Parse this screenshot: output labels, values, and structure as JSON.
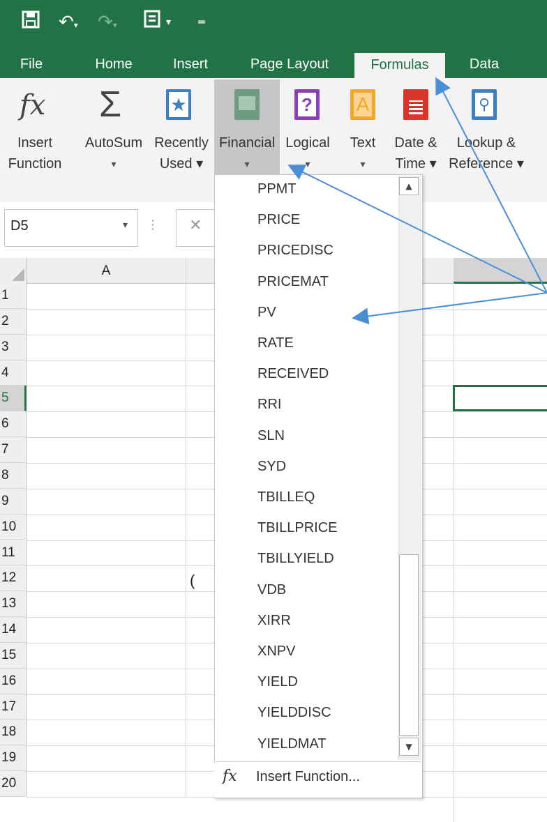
{
  "tabs": [
    {
      "label": "File"
    },
    {
      "label": "Home"
    },
    {
      "label": "Insert"
    },
    {
      "label": "Page Layout"
    },
    {
      "label": "Formulas"
    },
    {
      "label": "Data"
    }
  ],
  "ribbon": {
    "insert_function": {
      "line1": "Insert",
      "line2": "Function",
      "icon": "fx-icon"
    },
    "autosum": {
      "line1": "AutoSum",
      "line2": "▾",
      "icon": "sigma-icon"
    },
    "recently_used": {
      "line1": "Recently",
      "line2": "Used ▾",
      "icon": "star-book-icon"
    },
    "financial": {
      "line1": "Financial",
      "line2": "▾",
      "icon": "financial-book-icon"
    },
    "logical": {
      "line1": "Logical",
      "line2": "▾",
      "icon": "question-book-icon"
    },
    "text": {
      "line1": "Text",
      "line2": "▾",
      "icon": "text-book-icon"
    },
    "date_time": {
      "line1": "Date &",
      "line2": "Time ▾",
      "icon": "calendar-book-icon"
    },
    "lookup": {
      "line1": "Lookup &",
      "line2": "Reference ▾",
      "icon": "search-book-icon"
    }
  },
  "name_box": {
    "value": "D5"
  },
  "formula_bar": {
    "cancel": "✕"
  },
  "grid": {
    "column_a": "A",
    "rows": [
      "1",
      "2",
      "3",
      "4",
      "5",
      "6",
      "7",
      "8",
      "9",
      "10",
      "11",
      "12",
      "13",
      "14",
      "15",
      "16",
      "17",
      "18",
      "19",
      "20"
    ],
    "cell_b12": "("
  },
  "financial_menu": {
    "items": [
      "PPMT",
      "PRICE",
      "PRICEDISC",
      "PRICEMAT",
      "PV",
      "RATE",
      "RECEIVED",
      "RRI",
      "SLN",
      "SYD",
      "TBILLEQ",
      "TBILLPRICE",
      "TBILLYIELD",
      "VDB",
      "XIRR",
      "XNPV",
      "YIELD",
      "YIELDDISC",
      "YIELDMAT"
    ],
    "insert_function_label": "Insert Function...",
    "insert_function_icon": "fx"
  },
  "colors": {
    "excel_green": "#217346",
    "annotation_arrow": "#4a8fd6"
  }
}
